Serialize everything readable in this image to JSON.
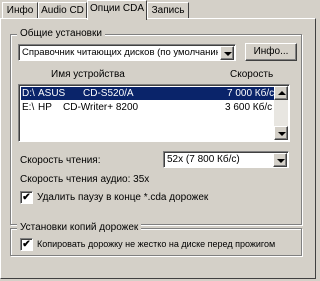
{
  "tabs": [
    "Инфо",
    "Audio CD",
    "Опции CDA",
    "Запись"
  ],
  "active_tab": 2,
  "general_group": {
    "legend": "Общие установки",
    "mode_select_value": "Справочник читающих дисков (по умолчанию)",
    "info_button_label": "Инфо..."
  },
  "device_table": {
    "headers": [
      "Имя устройства",
      "Скорость"
    ],
    "rows": [
      {
        "drive": "D:\\",
        "vendor": "ASUS",
        "model": "CD-S520/A",
        "speed": "7 000 Кб/с",
        "selected": true
      },
      {
        "drive": "E:\\",
        "vendor": "HP",
        "model": "CD-Writer+ 8200",
        "speed": "3 600 Кб/с",
        "selected": false
      }
    ]
  },
  "read_speed": {
    "label": "Скорость чтения:",
    "value": "52x (7 800 Кб/с)"
  },
  "audio_speed_text": "Скорость чтения аудио: 35x",
  "remove_pause_checkbox": {
    "label": "Удалить паузу в конце *.cda дорожек",
    "checked": true
  },
  "copy_group": {
    "legend": "Установки копий дорожек",
    "checkbox": {
      "label": "Копировать дорожку не жестко на диске перед прожигом",
      "checked": true
    }
  },
  "colors": {
    "face": "#d4d0c8",
    "selection": "#0a246a",
    "window": "#ffffff"
  }
}
